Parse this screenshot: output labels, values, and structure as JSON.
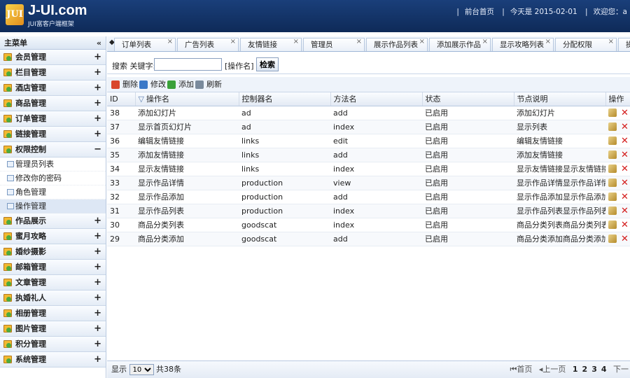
{
  "header": {
    "logo_icon": "JUI",
    "title": "J-UI.com",
    "subtitle": "JUI富客户端框架",
    "links": [
      "前台首页",
      "今天是 2015-02-01",
      "欢迎您：a"
    ]
  },
  "sidebar": {
    "title": "主菜单",
    "collapse_icon": "«",
    "sections_top": [
      {
        "label": "会员管理",
        "toggle": "+"
      },
      {
        "label": "栏目管理",
        "toggle": "+"
      },
      {
        "label": "酒店管理",
        "toggle": "+"
      },
      {
        "label": "商品管理",
        "toggle": "+"
      },
      {
        "label": "订单管理",
        "toggle": "+"
      },
      {
        "label": "链接管理",
        "toggle": "+"
      },
      {
        "label": "权限控制",
        "toggle": "−"
      }
    ],
    "sub_items": [
      "管理员列表",
      "修改你的密码",
      "角色管理",
      "操作管理"
    ],
    "active_sub": "操作管理",
    "sections_bottom": [
      {
        "label": "作品展示",
        "toggle": "+"
      },
      {
        "label": "蜜月攻略",
        "toggle": "+"
      },
      {
        "label": "婚纱摄影",
        "toggle": "+"
      },
      {
        "label": "邮箱管理",
        "toggle": "+"
      },
      {
        "label": "文章管理",
        "toggle": "+"
      },
      {
        "label": "执婚礼人",
        "toggle": "+"
      },
      {
        "label": "相册管理",
        "toggle": "+"
      },
      {
        "label": "图片管理",
        "toggle": "+"
      },
      {
        "label": "积分管理",
        "toggle": "+"
      },
      {
        "label": "系统管理",
        "toggle": "+"
      }
    ]
  },
  "tabs": {
    "nav_icon": "◆",
    "items": [
      "订单列表",
      "广告列表",
      "友情链接",
      "管理员",
      "展示作品列表",
      "添加展示作品",
      "显示攻略列表",
      "分配权限",
      "操"
    ]
  },
  "search": {
    "label": "搜索 关键字:",
    "value": "",
    "hint": "[操作名]",
    "button": "检索"
  },
  "toolbar": {
    "delete": "删除",
    "edit": "修改",
    "add": "添加",
    "refresh": "刷新",
    "colors": {
      "delete": "#d9472c",
      "edit": "#3a78c8",
      "add": "#3aa13a",
      "refresh": "#7a8a9c"
    }
  },
  "grid": {
    "columns": [
      "ID",
      "操作名",
      "控制器名",
      "方法名",
      "状态",
      "节点说明",
      "操作"
    ],
    "sort_icon": "▽",
    "rows": [
      [
        "38",
        "添加幻灯片",
        "ad",
        "add",
        "已启用",
        "添加幻灯片"
      ],
      [
        "37",
        "显示首页幻灯片",
        "ad",
        "index",
        "已启用",
        "显示列表"
      ],
      [
        "36",
        "编辑友情链接",
        "links",
        "edit",
        "已启用",
        "编辑友情链接"
      ],
      [
        "35",
        "添加友情链接",
        "links",
        "add",
        "已启用",
        "添加友情链接"
      ],
      [
        "34",
        "显示友情链接",
        "links",
        "index",
        "已启用",
        "显示友情链接显示友情链接"
      ],
      [
        "33",
        "显示作品详情",
        "production",
        "view",
        "已启用",
        "显示作品详情显示作品详情"
      ],
      [
        "32",
        "显示作品添加",
        "production",
        "add",
        "已启用",
        "显示作品添加显示作品添加显示"
      ],
      [
        "31",
        "显示作品列表",
        "production",
        "index",
        "已启用",
        "显示作品列表显示作品列表"
      ],
      [
        "30",
        "商品分类列表",
        "goodscat",
        "index",
        "已启用",
        "商品分类列表商品分类列表"
      ],
      [
        "29",
        "商品分类添加",
        "goodscat",
        "add",
        "已启用",
        "商品分类添加商品分类添加"
      ]
    ],
    "delete_icon": "✕"
  },
  "pager": {
    "show_label": "显示",
    "page_size": "10",
    "total": "共38条",
    "first": "首页",
    "prev": "上一页",
    "pages": [
      "1",
      "2",
      "3",
      "4"
    ],
    "current": "1",
    "next": "下一"
  }
}
